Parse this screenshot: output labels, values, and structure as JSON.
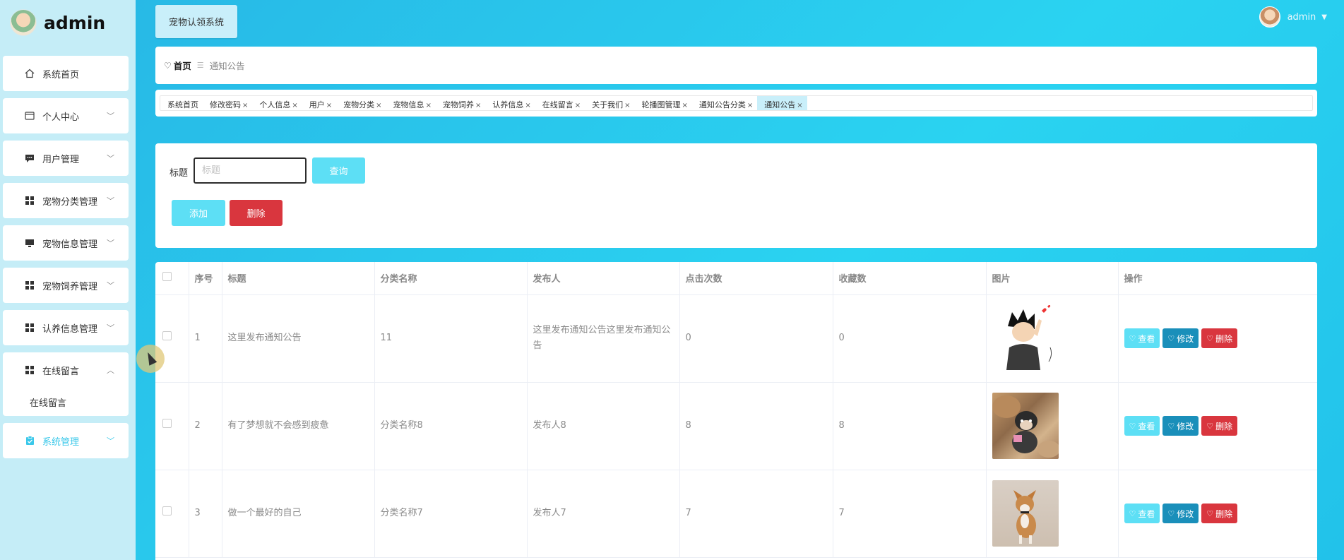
{
  "brand": {
    "name": "admin"
  },
  "sidebar": {
    "items": [
      {
        "label": "系统首页",
        "icon": "home-icon"
      },
      {
        "label": "个人中心",
        "icon": "card-icon"
      },
      {
        "label": "用户管理",
        "icon": "chat-icon"
      },
      {
        "label": "宠物分类管理",
        "icon": "grid-icon"
      },
      {
        "label": "宠物信息管理",
        "icon": "monitor-icon"
      },
      {
        "label": "宠物饲养管理",
        "icon": "grid-icon"
      },
      {
        "label": "认养信息管理",
        "icon": "grid-icon"
      },
      {
        "label": "在线留言",
        "icon": "grid-icon",
        "sub": "在线留言"
      },
      {
        "label": "系统管理",
        "icon": "clipboard-icon"
      }
    ]
  },
  "header": {
    "system_tag": "宠物认领系统",
    "user": "admin"
  },
  "breadcrumb": {
    "home": "首页",
    "current": "通知公告"
  },
  "tags": [
    "系统首页",
    "修改密码",
    "个人信息",
    "用户",
    "宠物分类",
    "宠物信息",
    "宠物饲养",
    "认养信息",
    "在线留言",
    "关于我们",
    "轮播图管理",
    "通知公告分类",
    "通知公告"
  ],
  "search": {
    "label": "标题",
    "placeholder": "标题",
    "query_button": "查询",
    "add_button": "添加",
    "delete_button": "删除"
  },
  "table": {
    "headers": [
      "序号",
      "标题",
      "分类名称",
      "发布人",
      "点击次数",
      "收藏数",
      "图片",
      "操作"
    ],
    "rows": [
      {
        "no": "1",
        "title": "这里发布通知公告",
        "category": "11",
        "publisher": "这里发布通知公告这里发布通知公告",
        "clicks": "0",
        "favorites": "0"
      },
      {
        "no": "2",
        "title": "有了梦想就不会感到疲惫",
        "category": "分类名称8",
        "publisher": "发布人8",
        "clicks": "8",
        "favorites": "8"
      },
      {
        "no": "3",
        "title": "做一个最好的自己",
        "category": "分类名称7",
        "publisher": "发布人7",
        "clicks": "7",
        "favorites": "7"
      }
    ],
    "actions": {
      "view": "查看",
      "edit": "修改",
      "delete": "删除"
    }
  }
}
